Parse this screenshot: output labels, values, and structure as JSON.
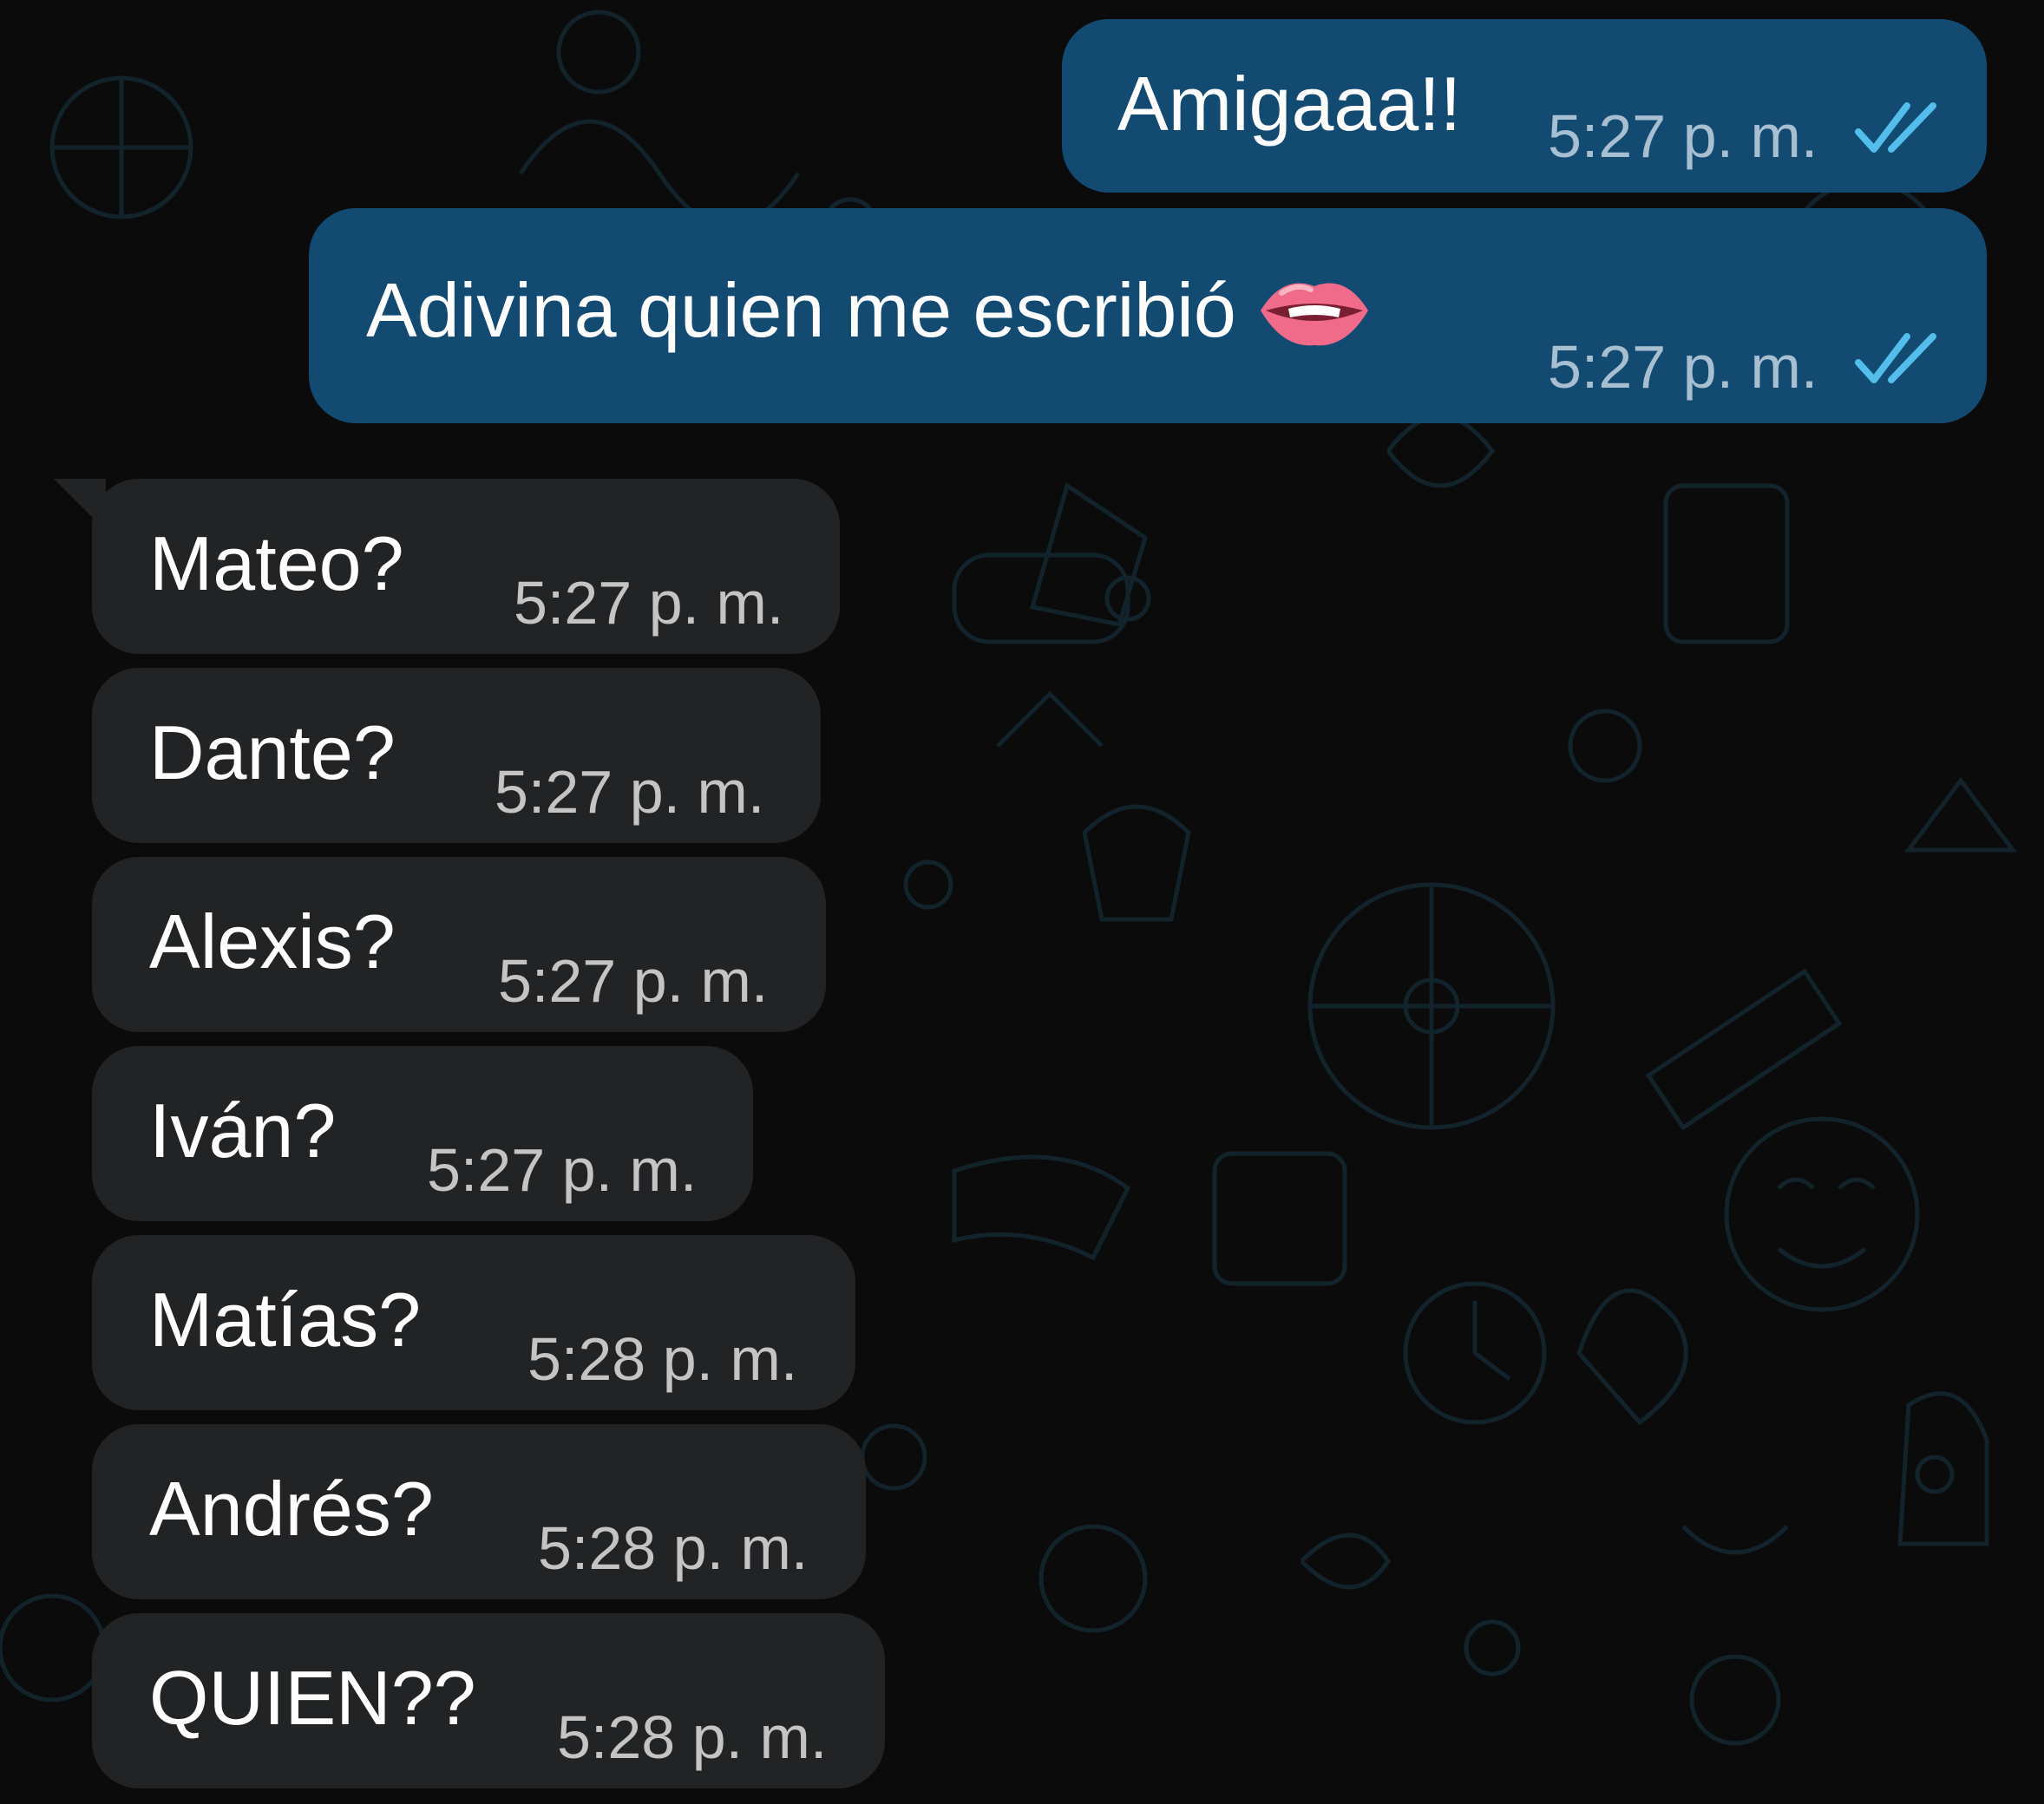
{
  "colors": {
    "background": "#0b0b0c",
    "outgoing_bubble": "#124a72",
    "incoming_bubble": "#222324",
    "read_ticks": "#53bdeb",
    "wallpaper_doodles": "#12232c"
  },
  "messages": [
    {
      "direction": "out",
      "text": "Amigaaa!!",
      "time": "5:27 p. m.",
      "status": "read"
    },
    {
      "direction": "out",
      "text": "Adivina quien me escribió",
      "emoji": "lips-biting-icon",
      "time": "5:27 p. m.",
      "status": "read"
    },
    {
      "direction": "in",
      "text": "Mateo?",
      "time": "5:27 p. m."
    },
    {
      "direction": "in",
      "text": "Dante?",
      "time": "5:27 p. m."
    },
    {
      "direction": "in",
      "text": "Alexis?",
      "time": "5:27 p. m."
    },
    {
      "direction": "in",
      "text": "Iván?",
      "time": "5:27 p. m."
    },
    {
      "direction": "in",
      "text": "Matías?",
      "time": "5:28 p. m."
    },
    {
      "direction": "in",
      "text": "Andrés?",
      "time": "5:28 p. m."
    },
    {
      "direction": "in",
      "text": "QUIEN??",
      "time": "5:28 p. m."
    }
  ]
}
